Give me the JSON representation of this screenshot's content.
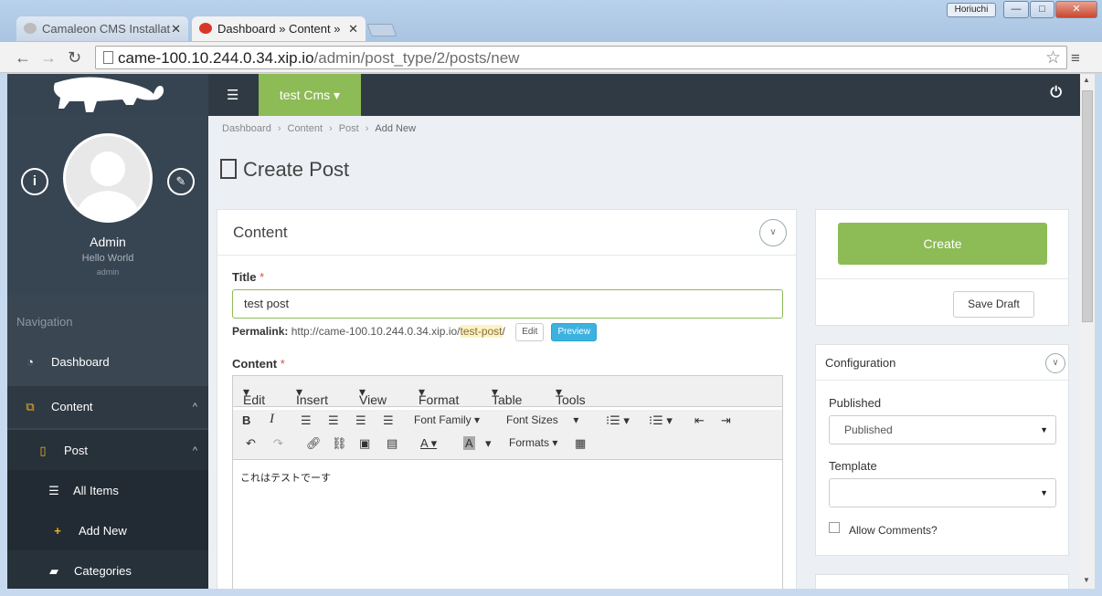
{
  "browser": {
    "tabs": [
      {
        "title": "Camaleon CMS Installat",
        "active": false
      },
      {
        "title": "Dashboard » Content »",
        "active": true
      }
    ],
    "user_badge": "Horiuchi",
    "url_host": "came-100.10.244.0.34.xip.io",
    "url_path": "/admin/post_type/2/posts/new"
  },
  "topbar": {
    "site_label": "test Cms"
  },
  "sidebar": {
    "admin_name": "Admin",
    "admin_tagline": "Hello World",
    "admin_role": "admin",
    "nav_header": "Navigation",
    "items": [
      {
        "label": "Dashboard",
        "icon": "dashboard-icon"
      },
      {
        "label": "Content",
        "icon": "content-icon"
      },
      {
        "label": "Post",
        "icon": "file-icon"
      },
      {
        "label": "All Items",
        "icon": "list-icon"
      },
      {
        "label": "Add New",
        "icon": "plus-icon"
      },
      {
        "label": "Categories",
        "icon": "folder-icon"
      }
    ]
  },
  "breadcrumb": [
    "Dashboard",
    "Content",
    "Post",
    "Add New"
  ],
  "page_title": "Create Post",
  "content_box": {
    "title": "Content",
    "title_label": "Title",
    "title_value": "test post",
    "permalink_label": "Permalink:",
    "permalink_base": "http://came-100.10.244.0.34.xip.io/",
    "permalink_slug": "test-post",
    "permalink_end": "/",
    "edit_label": "Edit",
    "preview_label": "Preview",
    "content_label": "Content",
    "editor_menu": [
      "Edit",
      "Insert",
      "View",
      "Format",
      "Table",
      "Tools"
    ],
    "font_family_label": "Font Family",
    "font_sizes_label": "Font Sizes",
    "formats_label": "Formats",
    "editor_text": "これはテストでーす"
  },
  "actions": {
    "create_label": "Create",
    "save_draft_label": "Save Draft"
  },
  "configuration": {
    "title": "Configuration",
    "published_label": "Published",
    "published_value": "Published",
    "template_label": "Template",
    "template_value": "",
    "allow_comments_label": "Allow Comments?"
  },
  "colors": {
    "accent": "#8dbb56",
    "sidebar": "#3a4651",
    "topbar": "#2f3a44",
    "preview": "#3cb2e0"
  }
}
